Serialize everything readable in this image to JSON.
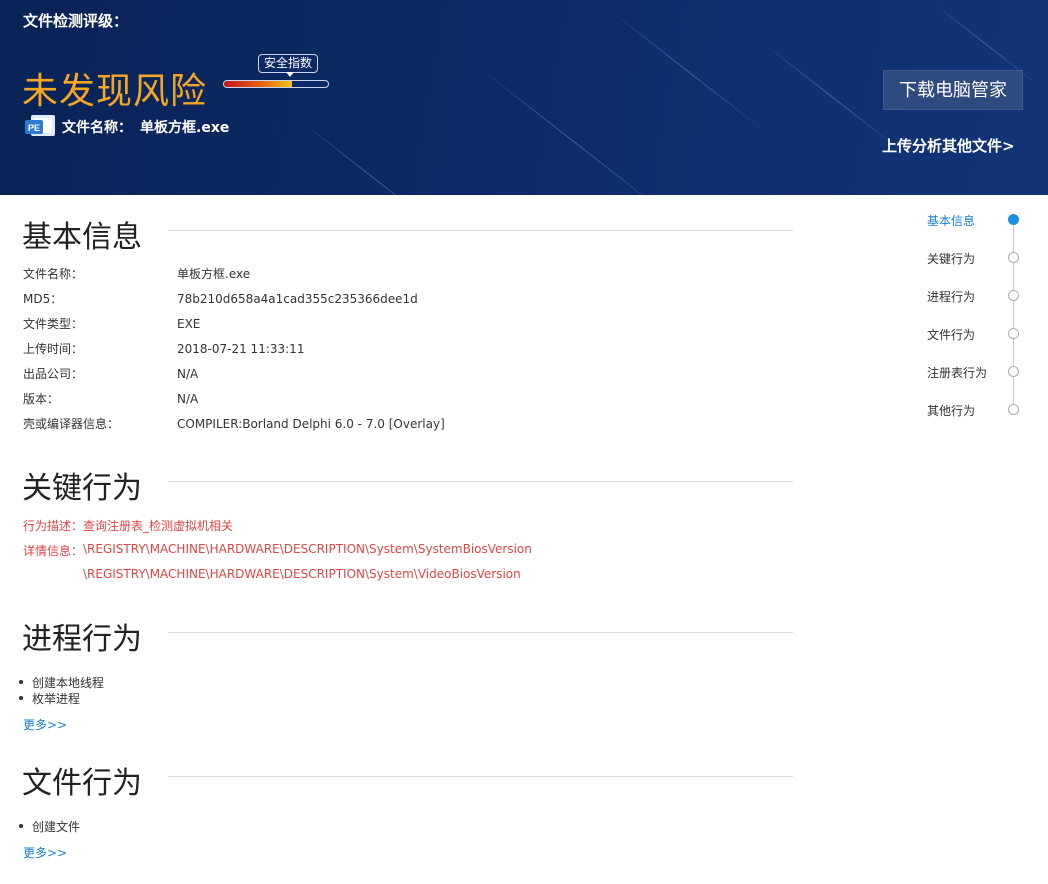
{
  "header": {
    "rating_label": "文件检测评级：",
    "verdict": "未发现风险",
    "gauge_label": "安全指数",
    "gauge_level": 0.65,
    "file_icon_text": "PE",
    "file_name_label": "文件名称：",
    "file_name": "单板方框.exe",
    "download_button": "下载电脑管家",
    "upload_link": "上传分析其他文件>"
  },
  "basic_info": {
    "title": "基本信息",
    "rows": [
      {
        "key": "文件名称：",
        "value": "单板方框.exe"
      },
      {
        "key": "MD5：",
        "value": "78b210d658a4a1cad355c235366dee1d"
      },
      {
        "key": "文件类型：",
        "value": "EXE"
      },
      {
        "key": "上传时间：",
        "value": "2018-07-21 11:33:11"
      },
      {
        "key": "出品公司：",
        "value": "N/A"
      },
      {
        "key": "版本：",
        "value": "N/A"
      },
      {
        "key": "壳或编译器信息：",
        "value": "COMPILER:Borland Delphi 6.0 - 7.0 [Overlay]"
      }
    ]
  },
  "key_behavior": {
    "title": "关键行为",
    "desc_label": "行为描述：",
    "desc_value": "查询注册表_检测虚拟机相关",
    "detail_label": "详情信息：",
    "details": [
      "\\REGISTRY\\MACHINE\\HARDWARE\\DESCRIPTION\\System\\SystemBiosVersion",
      "\\REGISTRY\\MACHINE\\HARDWARE\\DESCRIPTION\\System\\VideoBiosVersion"
    ]
  },
  "process_behavior": {
    "title": "进程行为",
    "items": [
      "创建本地线程",
      "枚举进程"
    ],
    "more": "更多>>"
  },
  "file_behavior": {
    "title": "文件行为",
    "items": [
      "创建文件"
    ],
    "more": "更多>>"
  },
  "side_nav": {
    "items": [
      "基本信息",
      "关键行为",
      "进程行为",
      "文件行为",
      "注册表行为",
      "其他行为"
    ],
    "active_index": 0
  },
  "colors": {
    "banner_bg": "#0d2a66",
    "verdict": "#f5a623",
    "accent_blue": "#1a8fe3",
    "warning_red": "#e04545"
  }
}
